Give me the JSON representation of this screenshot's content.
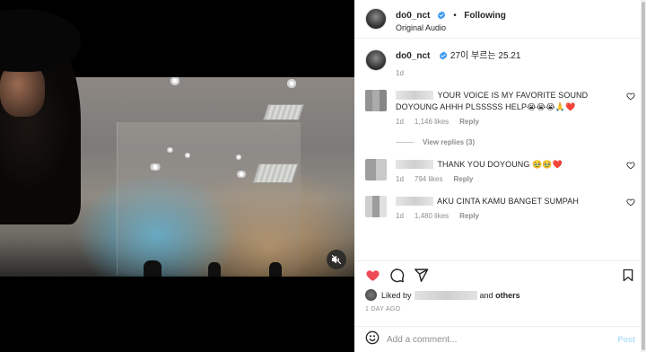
{
  "header": {
    "username": "do0_nct",
    "following_label": "Following",
    "audio_label": "Original Audio"
  },
  "caption": {
    "username": "do0_nct",
    "text": "27이 부르는 25.21",
    "time": "1d"
  },
  "comments": [
    {
      "text": "YOUR VOICE IS MY FAVORITE SOUND DOYOUNG AHHH PLSSSSS HELP😭😭😭🙏❤️",
      "time": "1d",
      "likes": "1,146 likes",
      "reply_label": "Reply",
      "view_replies": "View replies (3)"
    },
    {
      "text": "THANK YOU DOYOUNG 🥹🥹❤️",
      "time": "1d",
      "likes": "794 likes",
      "reply_label": "Reply"
    },
    {
      "text": "AKU CINTA KAMU BANGET SUMPAH",
      "time": "1d",
      "likes": "1,480 likes",
      "reply_label": "Reply"
    }
  ],
  "actions": {
    "liked_by_prefix": "Liked by",
    "liked_by_and": "and",
    "liked_by_others": "others",
    "post_time": "1 DAY AGO",
    "liked": true
  },
  "add_comment": {
    "placeholder": "Add a comment...",
    "post_label": "Post"
  },
  "colors": {
    "heart_red": "#ed4956",
    "verified_blue": "#3897f0",
    "post_disabled": "#b2dffc"
  }
}
